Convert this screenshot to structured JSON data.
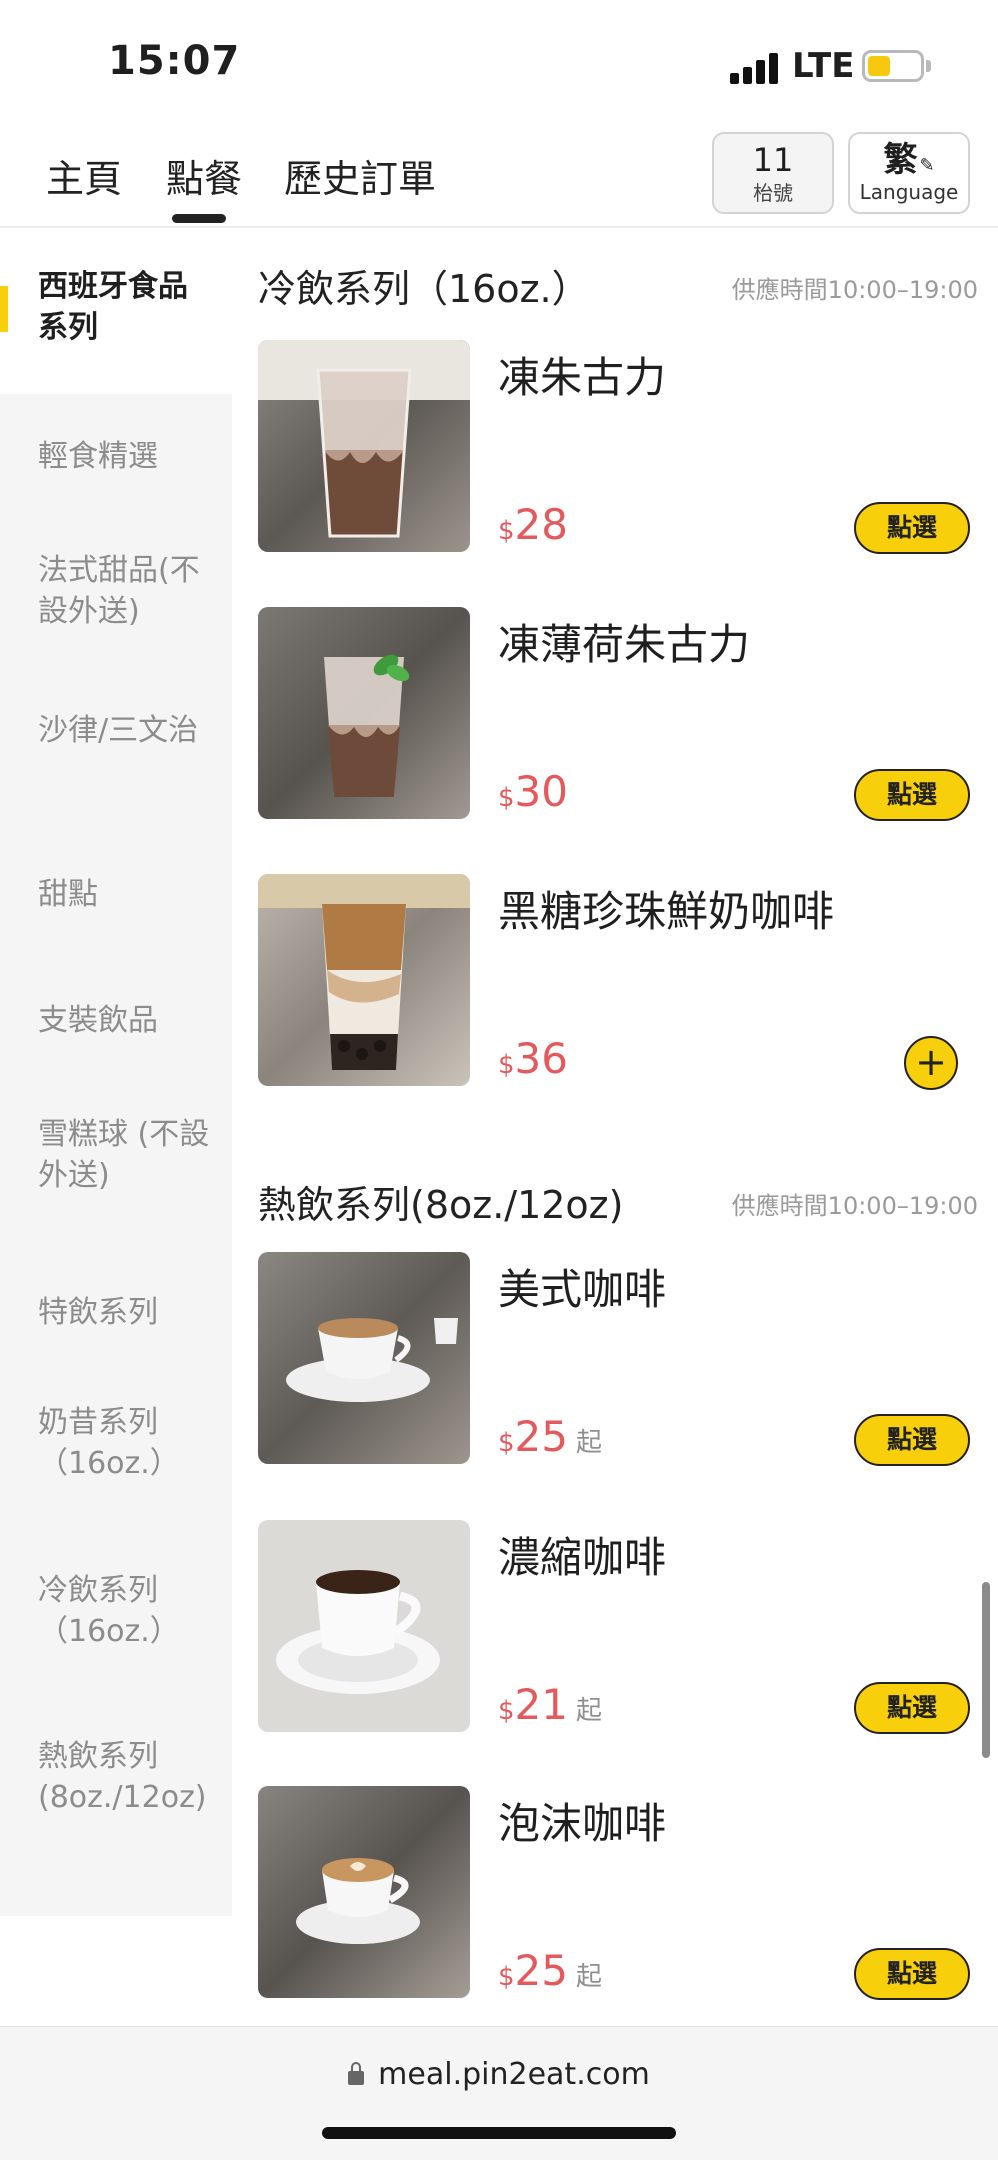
{
  "status_bar": {
    "time": "15:07",
    "network": "LTE"
  },
  "nav": {
    "tabs": [
      "主頁",
      "點餐",
      "歷史訂單"
    ],
    "active_tab": "點餐",
    "table_number": "11",
    "table_label": "枱號",
    "language_current": "繁",
    "language_label": "Language"
  },
  "sidebar": {
    "categories": [
      {
        "label": "西班牙食品系列",
        "active": true
      },
      {
        "label": "輕食精選"
      },
      {
        "label": "法式甜品(不設外送)"
      },
      {
        "label": "沙律/三文治"
      },
      {
        "label": "甜點"
      },
      {
        "label": "支裝飲品"
      },
      {
        "label": "雪糕球 (不設外送)"
      },
      {
        "label": "特飲系列"
      },
      {
        "label": "奶昔系列（16oz.）"
      },
      {
        "label": "冷飲系列（16oz.）"
      },
      {
        "label": "熱飲系列(8oz./12oz)"
      }
    ]
  },
  "sections": [
    {
      "title": "冷飲系列（16oz.）",
      "hours": "供應時間10:00–19:00",
      "items": [
        {
          "name": "凍朱古力",
          "currency": "$",
          "price": "28",
          "action": "點選",
          "image": "iced-chocolate"
        },
        {
          "name": "凍薄荷朱古力",
          "currency": "$",
          "price": "30",
          "action": "點選",
          "image": "iced-mint-chocolate"
        },
        {
          "name": "黑糖珍珠鮮奶咖啡",
          "currency": "$",
          "price": "36",
          "action": "plus",
          "image": "brown-sugar-boba-coffee"
        }
      ]
    },
    {
      "title": "熱飲系列(8oz./12oz)",
      "hours": "供應時間10:00–19:00",
      "items": [
        {
          "name": "美式咖啡",
          "currency": "$",
          "price": "25",
          "from": "起",
          "action": "點選",
          "image": "americano"
        },
        {
          "name": "濃縮咖啡",
          "currency": "$",
          "price": "21",
          "from": "起",
          "action": "點選",
          "image": "espresso"
        },
        {
          "name": "泡沫咖啡",
          "currency": "$",
          "price": "25",
          "from": "起",
          "action": "點選",
          "image": "cappuccino"
        }
      ]
    }
  ],
  "url_bar": {
    "url": "meal.pin2eat.com"
  },
  "colors": {
    "accent": "#f7cf0a",
    "price": "#e4595c",
    "muted": "#8c8c8c"
  }
}
